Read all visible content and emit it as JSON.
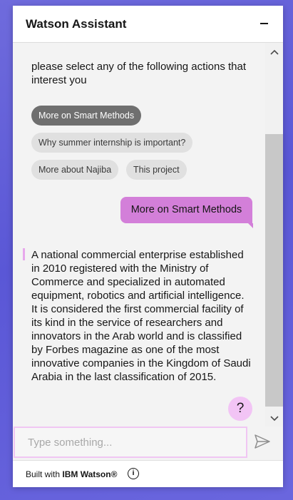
{
  "header": {
    "title": "Watson Assistant",
    "minimize_icon": "minimize-icon"
  },
  "messages": {
    "bot_prompt": "please select any of the following actions that interest you",
    "options": [
      {
        "label": "More on Smart Methods",
        "selected": true
      },
      {
        "label": "Why summer internship is important?",
        "selected": false
      },
      {
        "label": "More about Najiba",
        "selected": false
      },
      {
        "label": "This project",
        "selected": false
      }
    ],
    "user_message": "More on Smart Methods",
    "bot_answer": "A national commercial enterprise established in 2010 registered with the Ministry of Commerce and specialized in automated equipment, robotics and artificial intelligence. It is considered the first commercial facility of its kind in the service of researchers and innovators in the Arab world and is classified by Forbes magazine as one of the most innovative companies in the Kingdom of Saudi Arabia in the last classification of 2015.",
    "help_button_label": "?"
  },
  "input": {
    "placeholder": "Type something...",
    "value": ""
  },
  "footer": {
    "built_with": "Built with",
    "brand": "IBM Watson®",
    "info_icon_label": "i"
  },
  "colors": {
    "background": "#5a57d6",
    "user_bubble": "#d37fd9",
    "selected_chip": "#6f6f6f",
    "help_button": "#f2c4f5",
    "input_border": "#f0c6f3"
  }
}
